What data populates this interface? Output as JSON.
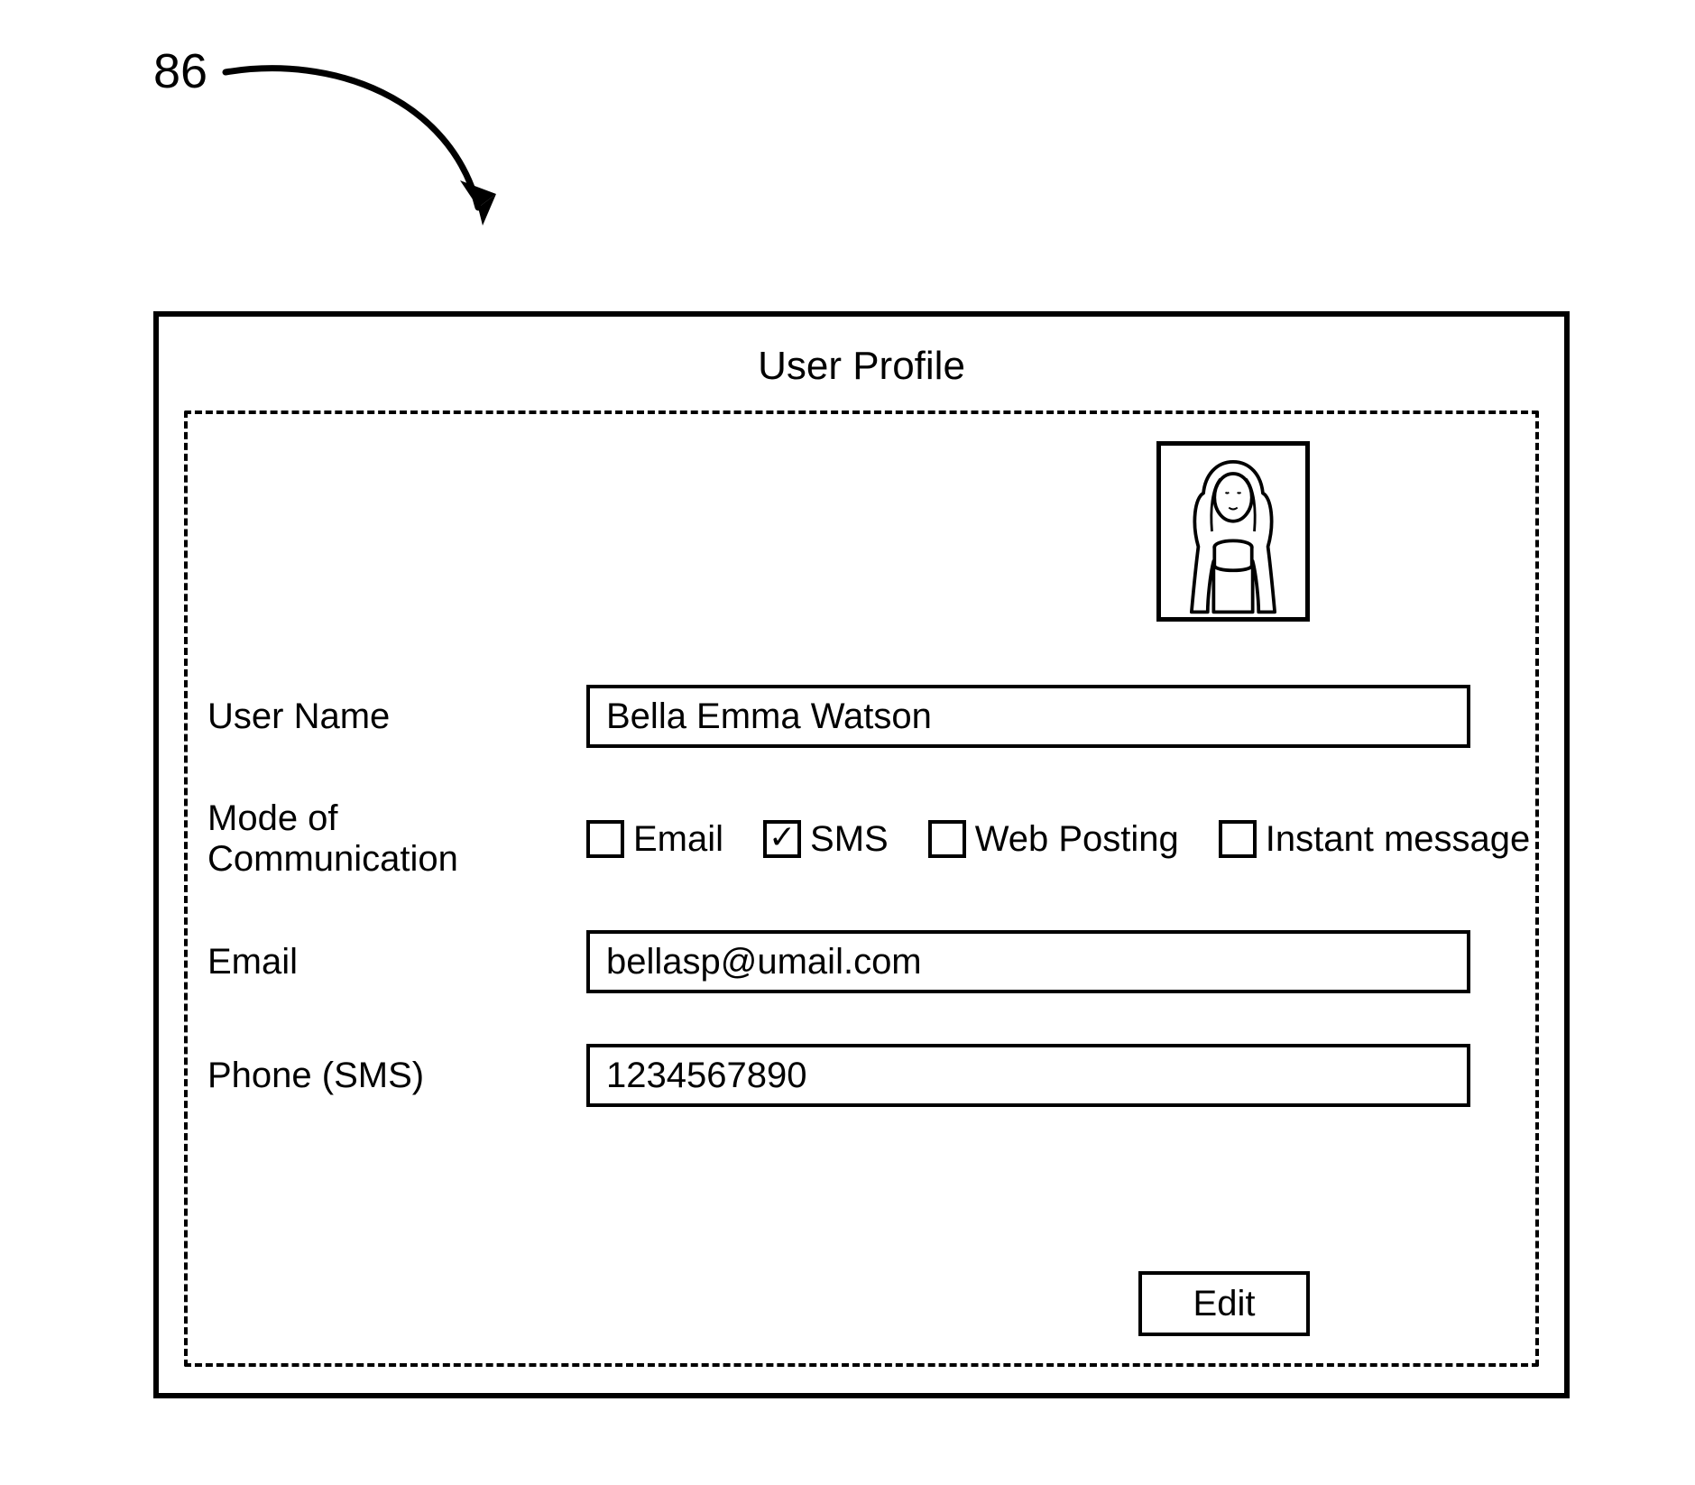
{
  "reference_number": "86",
  "window": {
    "title": "User Profile"
  },
  "form": {
    "labels": {
      "username": "User Name",
      "mode": "Mode of Communication",
      "email": "Email",
      "phone": "Phone (SMS)"
    },
    "values": {
      "username": "Bella Emma Watson",
      "email": "bellasp@umail.com",
      "phone": "1234567890"
    },
    "modes": {
      "email": {
        "label": "Email",
        "checked": false
      },
      "sms": {
        "label": "SMS",
        "checked": true
      },
      "web": {
        "label": "Web Posting",
        "checked": false
      },
      "im": {
        "label": "Instant message",
        "checked": false
      }
    }
  },
  "buttons": {
    "edit": "Edit"
  }
}
